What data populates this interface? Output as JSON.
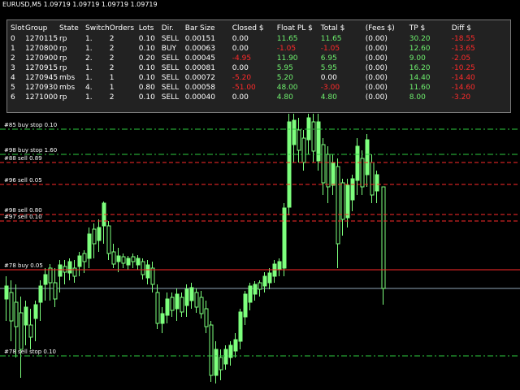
{
  "window": {
    "title": "EURUSD,M5  1.09719 1.09719 1.09719 1.09719"
  },
  "table": {
    "headers": [
      "Slot",
      "Group",
      "State",
      "Switch",
      "Orders",
      "Lots",
      "Dir.",
      "Bar Size",
      "Closed $",
      "Float PL $",
      "Total $",
      "(Fees $)",
      "TP $",
      "Diff $"
    ],
    "rows": [
      {
        "cells": [
          "0",
          "1270115",
          "rp",
          "1.",
          "2",
          "0.10",
          "SELL",
          "0.00151",
          "0.00",
          "11.65",
          "11.65",
          "(0.00)",
          "30.20",
          "-18.55"
        ],
        "colors": [
          "w",
          "w",
          "w",
          "w",
          "w",
          "w",
          "w",
          "w",
          "w",
          "g",
          "g",
          "w",
          "g",
          "r"
        ]
      },
      {
        "cells": [
          "1",
          "1270800",
          "rp",
          "1.",
          "2",
          "0.10",
          "BUY",
          "0.00063",
          "0.00",
          "-1.05",
          "-1.05",
          "(0.00)",
          "12.60",
          "-13.65"
        ],
        "colors": [
          "w",
          "w",
          "w",
          "w",
          "w",
          "w",
          "w",
          "w",
          "w",
          "r",
          "r",
          "w",
          "g",
          "r"
        ]
      },
      {
        "cells": [
          "2",
          "1270900",
          "rp",
          "2.",
          "2",
          "0.20",
          "SELL",
          "0.00045",
          "-4.95",
          "11.90",
          "6.95",
          "(0.00)",
          "9.00",
          "-2.05"
        ],
        "colors": [
          "w",
          "w",
          "w",
          "w",
          "w",
          "w",
          "w",
          "w",
          "r",
          "g",
          "g",
          "w",
          "g",
          "r"
        ]
      },
      {
        "cells": [
          "3",
          "1270915",
          "rp",
          "1.",
          "2",
          "0.10",
          "SELL",
          "0.00081",
          "0.00",
          "5.95",
          "5.95",
          "(0.00)",
          "16.20",
          "-10.25"
        ],
        "colors": [
          "w",
          "w",
          "w",
          "w",
          "w",
          "w",
          "w",
          "w",
          "w",
          "g",
          "g",
          "w",
          "g",
          "r"
        ]
      },
      {
        "cells": [
          "4",
          "1270945",
          "mbs",
          "1.",
          "1",
          "0.10",
          "SELL",
          "0.00072",
          "-5.20",
          "5.20",
          "0.00",
          "(0.00)",
          "14.40",
          "-14.40"
        ],
        "colors": [
          "w",
          "w",
          "w",
          "w",
          "w",
          "w",
          "w",
          "w",
          "r",
          "g",
          "w",
          "w",
          "g",
          "r"
        ]
      },
      {
        "cells": [
          "5",
          "1270930",
          "mbs",
          "4.",
          "1",
          "0.80",
          "SELL",
          "0.00058",
          "-51.00",
          "48.00",
          "-3.00",
          "(0.00)",
          "11.60",
          "-14.60"
        ],
        "colors": [
          "w",
          "w",
          "w",
          "w",
          "w",
          "w",
          "w",
          "w",
          "r",
          "g",
          "r",
          "w",
          "g",
          "r"
        ]
      },
      {
        "cells": [
          "6",
          "1271000",
          "rp",
          "1.",
          "2",
          "0.10",
          "SELL",
          "0.00040",
          "0.00",
          "4.80",
          "4.80",
          "(0.00)",
          "8.00",
          "-3.20"
        ],
        "colors": [
          "w",
          "w",
          "w",
          "w",
          "w",
          "w",
          "w",
          "w",
          "w",
          "g",
          "g",
          "w",
          "g",
          "r"
        ]
      }
    ]
  },
  "levels": [
    {
      "label": "#85 buy stop 0.10",
      "color": "#2ecc40",
      "style": "dashdot"
    },
    {
      "label": "#98 buy stop 1.60",
      "color": "#2ecc40",
      "style": "dashdot"
    },
    {
      "label": "#88 sell 0.89",
      "color": "#ff2a2a",
      "style": "dash"
    },
    {
      "label": "#96 sell 0.05",
      "color": "#ff2a2a",
      "style": "dash"
    },
    {
      "label": "#98 sell 0.80",
      "color": "#ff2a2a",
      "style": "dash"
    },
    {
      "label": "#97 sell 0.10",
      "color": "#ff2a2a",
      "style": "dash"
    },
    {
      "label": "#78 buy 0.05",
      "color": "#ff2a2a",
      "style": "solid"
    },
    {
      "label": "#78 sell stop 0.10",
      "color": "#2ecc40",
      "style": "dashdot"
    }
  ],
  "colors": {
    "background": "#000000",
    "bull": "#7dff7d",
    "bear": "#000000",
    "candle_outline": "#7dff7d",
    "bid_line": "#8fa6b8"
  }
}
